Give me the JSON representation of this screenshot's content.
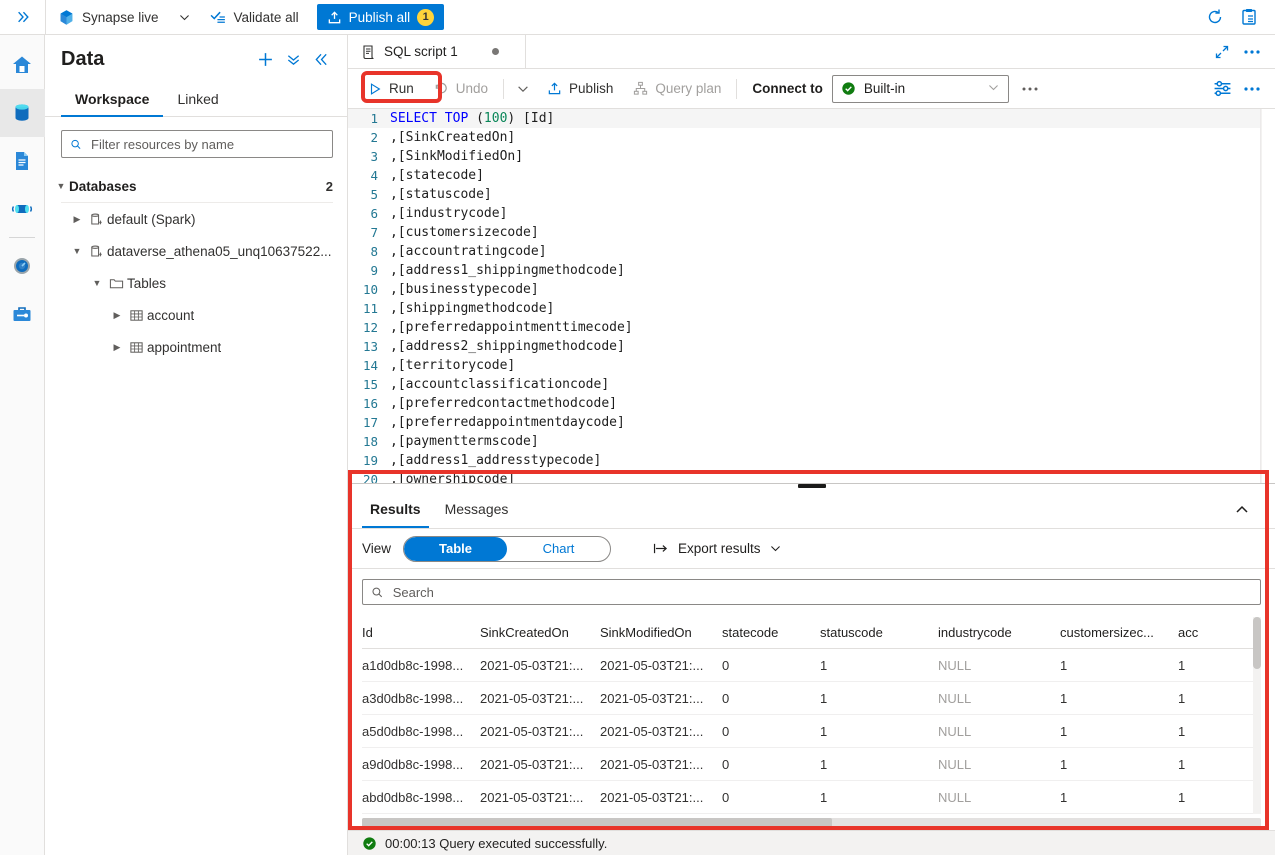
{
  "topbar": {
    "expand_icon": "chevron-double-right-icon",
    "mode_label": "Synapse live",
    "mode_icon": "synapse-icon",
    "mode_chevron": "chevron-down-icon",
    "validate_all_label": "Validate all",
    "validate_all_icon": "validate-icon",
    "publish_all_label": "Publish all",
    "publish_all_icon": "upload-icon",
    "publish_all_count": "1",
    "refresh_icon": "refresh-icon",
    "tasks_icon": "clipboard-tasks-icon"
  },
  "rail": {
    "items": [
      {
        "name": "home",
        "icon": "home-icon"
      },
      {
        "name": "data",
        "icon": "database-icon",
        "active": true
      },
      {
        "name": "develop",
        "icon": "document-icon"
      },
      {
        "name": "integrate",
        "icon": "pipeline-icon"
      },
      {
        "name": "monitor",
        "icon": "gauge-icon"
      },
      {
        "name": "manage",
        "icon": "toolbox-icon"
      }
    ]
  },
  "data_panel": {
    "title": "Data",
    "actions": [
      {
        "name": "add",
        "icon": "plus-icon"
      },
      {
        "name": "actions",
        "icon": "chevron-double-down-icon"
      },
      {
        "name": "collapse",
        "icon": "chevron-double-left-icon"
      }
    ],
    "tabs": [
      {
        "label": "Workspace",
        "active": true
      },
      {
        "label": "Linked",
        "active": false
      }
    ],
    "search": {
      "placeholder": "Filter resources by name",
      "value": "",
      "icon": "search-icon"
    },
    "tree": {
      "group_label": "Databases",
      "group_count": "2",
      "nodes": [
        {
          "label": "default (Spark)",
          "icon": "database-sql-icon",
          "caret": "collapsed",
          "indent": 1
        },
        {
          "label": "dataverse_athena05_unq10637522...",
          "icon": "database-sql-icon",
          "caret": "expanded",
          "indent": 1
        },
        {
          "label": "Tables",
          "icon": "folder-icon",
          "caret": "expanded",
          "indent": 2
        },
        {
          "label": "account",
          "icon": "table-icon",
          "caret": "collapsed",
          "indent": 3
        },
        {
          "label": "appointment",
          "icon": "table-icon",
          "caret": "collapsed",
          "indent": 3
        }
      ]
    }
  },
  "document_tab": {
    "label": "SQL script 1",
    "icon": "sql-script-icon",
    "dirty": true,
    "right_actions": [
      {
        "name": "expand-editor",
        "icon": "expand-diagonal-icon"
      },
      {
        "name": "more-tab-actions",
        "icon": "ellipsis-icon"
      }
    ]
  },
  "command_bar": {
    "run_label": "Run",
    "run_icon": "play-icon",
    "undo_label": "Undo",
    "undo_icon": "undo-icon",
    "undo_chevron": "chevron-down-icon",
    "publish_label": "Publish",
    "publish_icon": "upload-icon",
    "query_plan_label": "Query plan",
    "query_plan_icon": "query-plan-icon",
    "connect_to_label": "Connect to",
    "connect_to_value": "Built-in",
    "connect_status_icon": "check-circle-green-icon",
    "connect_chevron": "chevron-down-icon",
    "more_icon": "ellipsis-icon",
    "settings_icon": "sliders-icon",
    "more_right_icon": "ellipsis-icon"
  },
  "editor": {
    "lines": [
      {
        "n": "1",
        "pre": "",
        "kw": "SELECT TOP ",
        "mid": "(",
        "num": "100",
        "post": ") [Id]"
      },
      {
        "n": "2",
        "text": ",[SinkCreatedOn]"
      },
      {
        "n": "3",
        "text": ",[SinkModifiedOn]"
      },
      {
        "n": "4",
        "text": ",[statecode]"
      },
      {
        "n": "5",
        "text": ",[statuscode]"
      },
      {
        "n": "6",
        "text": ",[industrycode]"
      },
      {
        "n": "7",
        "text": ",[customersizecode]"
      },
      {
        "n": "8",
        "text": ",[accountratingcode]"
      },
      {
        "n": "9",
        "text": ",[address1_shippingmethodcode]"
      },
      {
        "n": "10",
        "text": ",[businesstypecode]"
      },
      {
        "n": "11",
        "text": ",[shippingmethodcode]"
      },
      {
        "n": "12",
        "text": ",[preferredappointmenttimecode]"
      },
      {
        "n": "13",
        "text": ",[address2_shippingmethodcode]"
      },
      {
        "n": "14",
        "text": ",[territorycode]"
      },
      {
        "n": "15",
        "text": ",[accountclassificationcode]"
      },
      {
        "n": "16",
        "text": ",[preferredcontactmethodcode]"
      },
      {
        "n": "17",
        "text": ",[preferredappointmentdaycode]"
      },
      {
        "n": "18",
        "text": ",[paymenttermscode]"
      },
      {
        "n": "19",
        "text": ",[address1_addresstypecode]"
      },
      {
        "n": "20",
        "text": ",[ownershipcode]"
      }
    ]
  },
  "results": {
    "tabs": [
      {
        "label": "Results",
        "active": true
      },
      {
        "label": "Messages",
        "active": false
      }
    ],
    "collapse_icon": "chevron-up-icon",
    "view_label": "View",
    "view_options": [
      {
        "label": "Table",
        "selected": true
      },
      {
        "label": "Chart",
        "selected": false
      }
    ],
    "export_label": "Export results",
    "export_icon": "export-icon",
    "export_chevron": "chevron-down-icon",
    "search": {
      "placeholder": "Search",
      "value": "",
      "icon": "search-icon"
    },
    "columns": [
      "Id",
      "SinkCreatedOn",
      "SinkModifiedOn",
      "statecode",
      "statuscode",
      "industrycode",
      "customersizec...",
      "acc"
    ],
    "rows": [
      [
        "a1d0db8c-1998...",
        "2021-05-03T21:...",
        "2021-05-03T21:...",
        "0",
        "1",
        "NULL",
        "1",
        "1"
      ],
      [
        "a3d0db8c-1998...",
        "2021-05-03T21:...",
        "2021-05-03T21:...",
        "0",
        "1",
        "NULL",
        "1",
        "1"
      ],
      [
        "a5d0db8c-1998...",
        "2021-05-03T21:...",
        "2021-05-03T21:...",
        "0",
        "1",
        "NULL",
        "1",
        "1"
      ],
      [
        "a9d0db8c-1998...",
        "2021-05-03T21:...",
        "2021-05-03T21:...",
        "0",
        "1",
        "NULL",
        "1",
        "1"
      ],
      [
        "abd0db8c-1998...",
        "2021-05-03T21:...",
        "2021-05-03T21:...",
        "0",
        "1",
        "NULL",
        "1",
        "1"
      ]
    ]
  },
  "status_bar": {
    "icon": "check-circle-green-icon",
    "text": "00:00:13 Query executed successfully."
  },
  "colors": {
    "accent": "#0078d4",
    "highlight_box": "#e8342a",
    "success": "#107c10",
    "badge": "#ffd43b",
    "keyword": "#0000ff",
    "number": "#098658",
    "lineno": "#237893"
  }
}
